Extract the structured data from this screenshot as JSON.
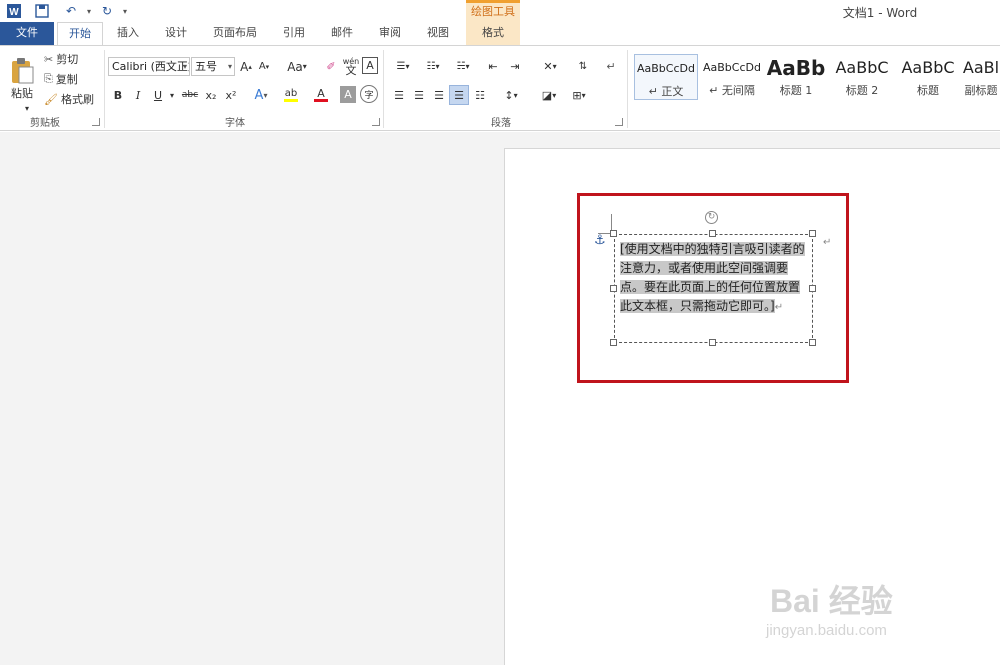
{
  "window": {
    "title": "文档1 - Word",
    "context_header": "绘图工具"
  },
  "quick_access": {
    "word_icon": "word-app-icon",
    "save_icon": "save-icon",
    "undo_icon": "undo-icon",
    "redo_icon": "redo-icon",
    "customize_icon": "customize-quick-access-icon"
  },
  "tabs": {
    "file": "文件",
    "home": "开始",
    "insert": "插入",
    "design": "设计",
    "layout": "页面布局",
    "references": "引用",
    "mailings": "邮件",
    "review": "审阅",
    "view": "视图",
    "format": "格式"
  },
  "clipboard": {
    "label": "剪贴板",
    "paste": "粘贴",
    "cut": "剪切",
    "copy": "复制",
    "format_painter": "格式刷"
  },
  "font": {
    "label": "字体",
    "font_name": "Calibri (西文正文)",
    "font_size": "五号",
    "grow": "A",
    "shrink": "A",
    "change_case": "Aa",
    "phonetic": "wén",
    "phonetic_sub": "文",
    "border_char": "A",
    "bold": "B",
    "italic": "I",
    "underline": "U",
    "strike": "abc",
    "subscript": "x₂",
    "superscript": "x²",
    "text_effect": "A",
    "highlight": "ab",
    "font_color": "A",
    "char_shading": "A",
    "enclose": "字"
  },
  "paragraph": {
    "label": "段落"
  },
  "styles": {
    "items": [
      {
        "sample": "AaBbCcDd",
        "name": "↵ 正文"
      },
      {
        "sample": "AaBbCcDd",
        "name": "↵ 无间隔"
      },
      {
        "sample": "AaBb",
        "name": "标题 1"
      },
      {
        "sample": "AaBbC",
        "name": "标题 2"
      },
      {
        "sample": "AaBbC",
        "name": "标题"
      },
      {
        "sample": "AaBl",
        "name": "副标题"
      }
    ]
  },
  "document": {
    "textbox_text": "[使用文档中的独特引言吸引读者的注意力，或者使用此空间强调要点。要在此页面上的任何位置放置此文本框，只需拖动它即可。]",
    "para_mark": "↵",
    "anchor_icon": "anchor-icon"
  },
  "watermark": {
    "brand": "Bai 经验",
    "url": "jingyan.baidu.com"
  },
  "colors": {
    "accent": "#2b579a",
    "context_tab": "#fbe7c6",
    "highlight_border": "#c0141c"
  }
}
